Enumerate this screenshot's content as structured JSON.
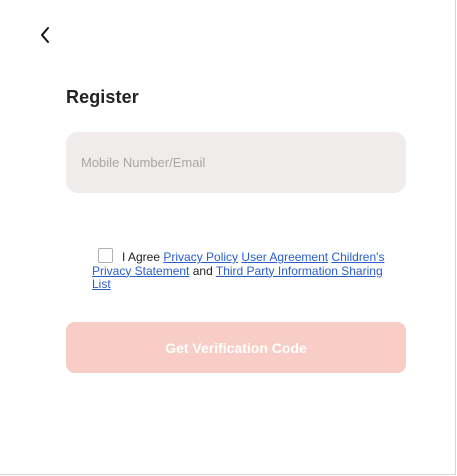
{
  "header": {
    "back_icon": "chevron-left-icon",
    "title": "Register"
  },
  "account_input": {
    "placeholder": "Mobile Number/Email",
    "value": ""
  },
  "agreement": {
    "checked": false,
    "prefix": "I Agree",
    "privacy_policy": "Privacy Policy",
    "user_agreement": "User Agreement",
    "children_privacy": "Children's Privacy Statement",
    "and": "and",
    "third_party": "Third Party Information Sharing List"
  },
  "verify_button": {
    "label": "Get Verification Code",
    "enabled": false
  },
  "colors": {
    "input_bg": "#efeceb",
    "button_bg_disabled": "#f8cdc5",
    "link": "#2a5ecb",
    "title": "#222222"
  }
}
